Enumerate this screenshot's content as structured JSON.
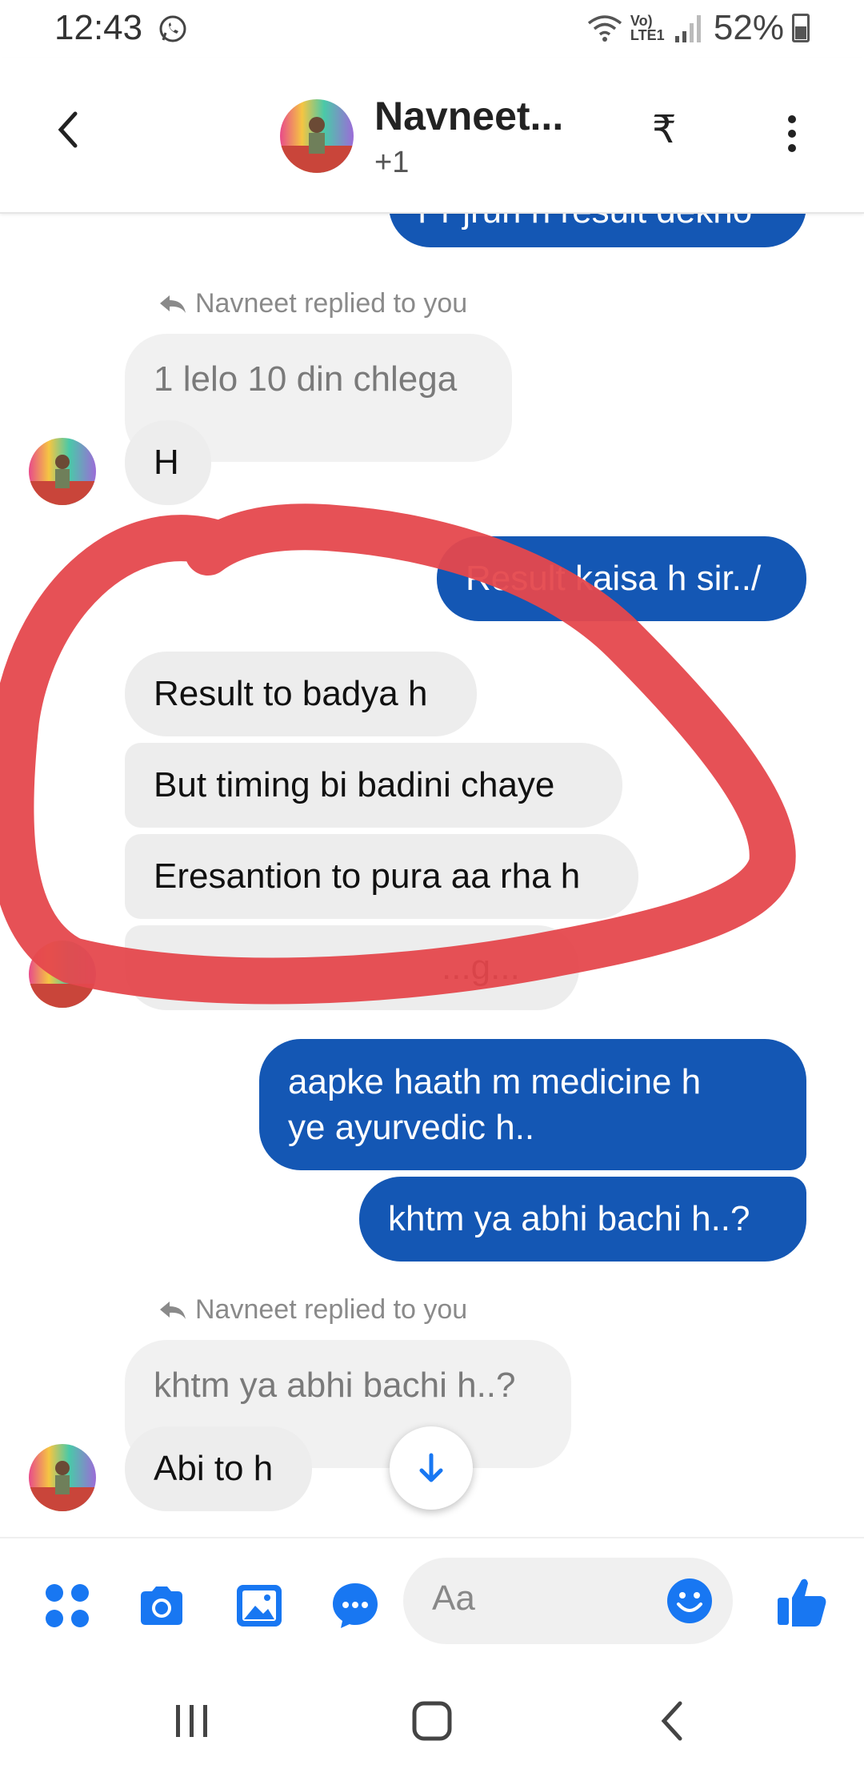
{
  "status_bar": {
    "time": "12:43",
    "network": "Vo) LTE1",
    "battery": "52%"
  },
  "header": {
    "name": "Navneet...",
    "sub": "+1",
    "rupee": "₹"
  },
  "messages": {
    "top_partial": "Pr jruri h result dekho",
    "reply_label_1": "Navneet replied to you",
    "quote_1": "1 lelo 10 din chlega",
    "in_1": "H",
    "out_1": "Result kaisa h sir../",
    "in_2": "Result to badya h",
    "in_3": "But timing bi badini chaye",
    "in_4": "Eresantion to pura aa rha h",
    "in_5_partial": "...g...",
    "out_2_line1": "aapke haath m medicine h",
    "out_2_line2": "ye ayurvedic h..",
    "out_3": "khtm ya abhi bachi h..?",
    "reply_label_2": "Navneet replied to you",
    "quote_2": "khtm ya abhi bachi h..?",
    "in_6": "Abi to h"
  },
  "composer": {
    "placeholder": "Aa"
  },
  "colors": {
    "outgoing": "#1457b4",
    "incoming": "#ededed",
    "accent": "#1877f2",
    "annotation": "#e5484d"
  }
}
